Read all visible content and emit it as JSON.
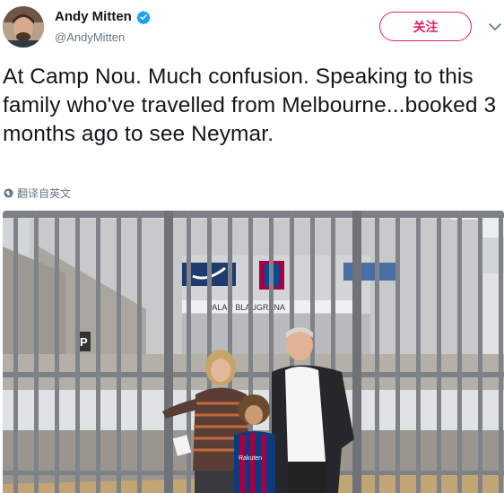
{
  "user": {
    "display_name": "Andy Mitten",
    "handle": "@AndyMitten",
    "verified": true
  },
  "actions": {
    "follow_label": "关注",
    "more_icon": "chevron-down-icon"
  },
  "tweet": {
    "text": "At Camp Nou. Much confusion. Speaking to this family who've travelled from Melbourne...booked 3 months ago to see Neymar.",
    "translate_label": "翻译自英文"
  },
  "photo": {
    "sign_text": "PALAU BLAUGRANA",
    "parking_sign": "P",
    "shirt_text": "Rakuten"
  },
  "colors": {
    "accent": "#e0245e",
    "verified_blue": "#1da1f2",
    "secondary_text": "#657786"
  }
}
